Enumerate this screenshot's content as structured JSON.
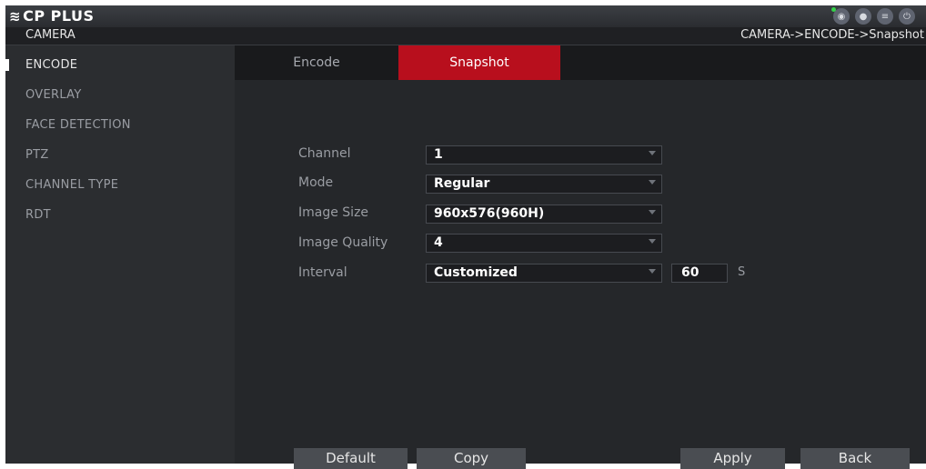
{
  "header": {
    "logo_mark": "≋",
    "logo_text": "CP PLUS",
    "icons": [
      "eye-icon",
      "user-icon",
      "menu-icon",
      "power-icon"
    ]
  },
  "titlebar": {
    "section": "CAMERA",
    "breadcrumb": "CAMERA->ENCODE->Snapshot"
  },
  "sidebar": {
    "items": [
      {
        "label": "ENCODE",
        "active": true
      },
      {
        "label": "OVERLAY"
      },
      {
        "label": "FACE DETECTION"
      },
      {
        "label": "PTZ"
      },
      {
        "label": "CHANNEL TYPE"
      },
      {
        "label": "RDT"
      }
    ]
  },
  "tabs": [
    {
      "label": "Encode",
      "active": false
    },
    {
      "label": "Snapshot",
      "active": true
    }
  ],
  "form": {
    "channel": {
      "label": "Channel",
      "value": "1"
    },
    "mode": {
      "label": "Mode",
      "value": "Regular"
    },
    "image_size": {
      "label": "Image Size",
      "value": "960x576(960H)"
    },
    "image_quality": {
      "label": "Image Quality",
      "value": "4"
    },
    "interval": {
      "label": "Interval",
      "value": "Customized",
      "seconds": "60",
      "unit": "S"
    }
  },
  "buttons": {
    "default": "Default",
    "copy": "Copy",
    "apply": "Apply",
    "back": "Back"
  },
  "colors": {
    "accent": "#b80f1d",
    "background": "#2b2d30",
    "tabbar": "#191a1c"
  }
}
